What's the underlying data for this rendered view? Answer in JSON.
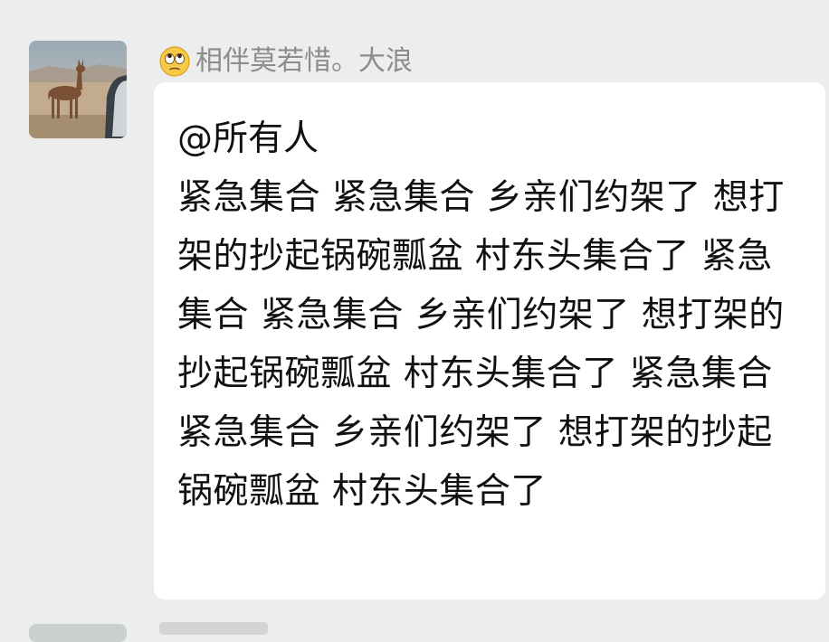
{
  "message": {
    "sender_name": "相伴莫若惜。大浪",
    "sender_emoji_icon": "rolling-eyes-emoji-icon",
    "avatar_icon": "llama-avatar-icon",
    "mention": "@所有人",
    "body": "紧急集合 紧急集合 乡亲们约架了 想打架的抄起锅碗瓢盆 村东头集合了 紧急集合 紧急集合 乡亲们约架了 想打架的抄起锅碗瓢盆 村东头集合了 紧急集合 紧急集合 乡亲们约架了 想打架的抄起锅碗瓢盆 村东头集合了"
  },
  "colors": {
    "background": "#ededed",
    "bubble": "#ffffff",
    "text": "#111111",
    "sender_name": "#8c8c8c"
  }
}
